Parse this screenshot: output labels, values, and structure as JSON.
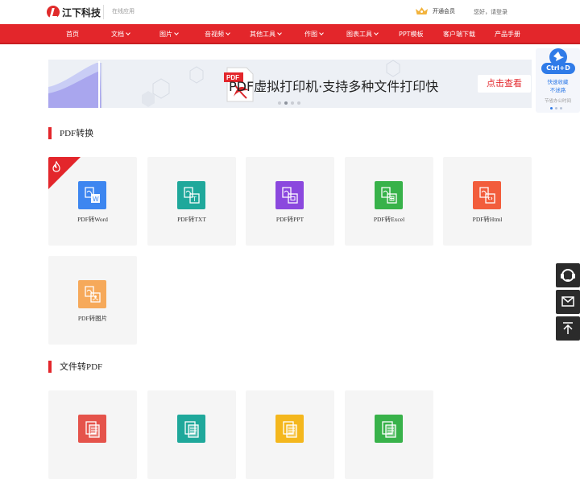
{
  "header": {
    "logo_text": "江下科技",
    "online_apps": "在线应用",
    "vip_label": "开通会员",
    "login_text": "您好，请登录"
  },
  "nav": {
    "items": [
      {
        "label": "首页",
        "dropdown": false
      },
      {
        "label": "文档",
        "dropdown": true
      },
      {
        "label": "图片",
        "dropdown": true
      },
      {
        "label": "音视频",
        "dropdown": true
      },
      {
        "label": "其他工具",
        "dropdown": true
      },
      {
        "label": "作图",
        "dropdown": true
      },
      {
        "label": "图表工具",
        "dropdown": true
      },
      {
        "label": "PPT模板",
        "dropdown": false
      },
      {
        "label": "客户端下载",
        "dropdown": false
      },
      {
        "label": "产品手册",
        "dropdown": false
      }
    ]
  },
  "banner": {
    "title": "PDF虚拟打印机·支持多种文件打印快",
    "button": "点击查看",
    "pdf_badge": "PDF"
  },
  "bookmark": {
    "shortcut": "Ctrl+D",
    "line1": "快速收藏",
    "line2": "不迷路",
    "line3": "节省办公时间"
  },
  "sections": [
    {
      "title": "PDF转换",
      "tools": [
        {
          "label": "PDF转Word",
          "color": "#3d86f0",
          "icon": "word-doc-icon",
          "hot": true
        },
        {
          "label": "PDF转TXT",
          "color": "#1fa89b",
          "icon": "txt-doc-icon",
          "hot": false
        },
        {
          "label": "PDF转PPT",
          "color": "#8b48de",
          "icon": "ppt-doc-icon",
          "hot": false
        },
        {
          "label": "PDF转Excel",
          "color": "#38b24a",
          "icon": "excel-doc-icon",
          "hot": false
        },
        {
          "label": "PDF转Html",
          "color": "#f25d3c",
          "icon": "html-doc-icon",
          "hot": false
        },
        {
          "label": "PDF转图片",
          "color": "#f6a95a",
          "icon": "image-doc-icon",
          "hot": false
        }
      ]
    },
    {
      "title": "文件转PDF",
      "tools": [
        {
          "color": "#e5534b",
          "icon": "word-to-pdf-icon"
        },
        {
          "color": "#1fa89b",
          "icon": "image-to-pdf-icon"
        },
        {
          "color": "#f4b71d",
          "icon": "ppt-to-pdf-icon"
        },
        {
          "color": "#38b24a",
          "icon": "excel-to-pdf-icon"
        }
      ]
    }
  ],
  "sidebar": {
    "buttons": [
      {
        "icon": "customer-service-icon"
      },
      {
        "icon": "mail-icon"
      },
      {
        "icon": "back-to-top-icon"
      }
    ]
  }
}
